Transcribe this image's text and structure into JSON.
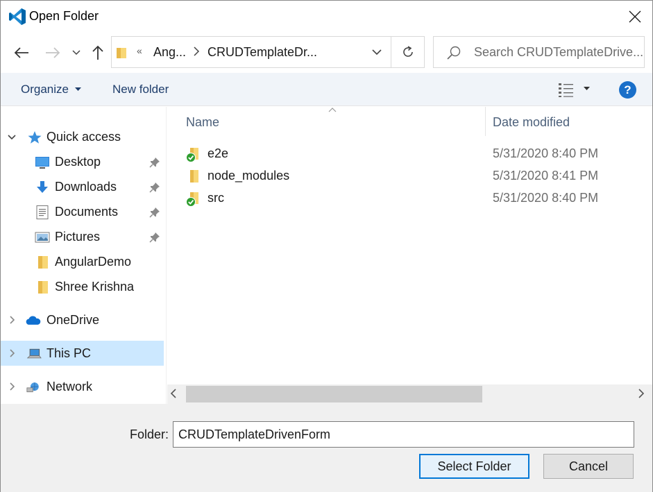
{
  "window": {
    "title": "Open Folder"
  },
  "address": {
    "overflow_marker": "«",
    "crumbs": [
      "Ang...",
      "CRUDTemplateDr..."
    ]
  },
  "search": {
    "placeholder": "Search CRUDTemplateDrive..."
  },
  "toolbar": {
    "organize": "Organize",
    "new_folder": "New folder",
    "help": "?"
  },
  "nav": {
    "quick_access": "Quick access",
    "quick_items": [
      {
        "label": "Desktop",
        "icon": "desktop-icon",
        "pinned": true
      },
      {
        "label": "Downloads",
        "icon": "downloads-icon",
        "pinned": true
      },
      {
        "label": "Documents",
        "icon": "documents-icon",
        "pinned": true
      },
      {
        "label": "Pictures",
        "icon": "pictures-icon",
        "pinned": true
      },
      {
        "label": "AngularDemo",
        "icon": "folder-icon",
        "pinned": false
      },
      {
        "label": "Shree Krishna",
        "icon": "folder-icon",
        "pinned": false
      }
    ],
    "onedrive": "OneDrive",
    "this_pc": "This PC",
    "network": "Network"
  },
  "columns": {
    "name": "Name",
    "date": "Date modified"
  },
  "files": [
    {
      "name": "e2e",
      "date": "5/31/2020 8:40 PM",
      "synced": true
    },
    {
      "name": "node_modules",
      "date": "5/31/2020 8:41 PM",
      "synced": false
    },
    {
      "name": "src",
      "date": "5/31/2020 8:40 PM",
      "synced": true
    }
  ],
  "bottom": {
    "folder_label": "Folder:",
    "folder_value": "CRUDTemplateDrivenForm",
    "select_button": "Select Folder",
    "cancel_button": "Cancel"
  },
  "colors": {
    "accent": "#0078d7",
    "selection": "#cce8ff",
    "toolbar_bg": "#f0f4f9",
    "vscode_blue": "#0065a9"
  }
}
